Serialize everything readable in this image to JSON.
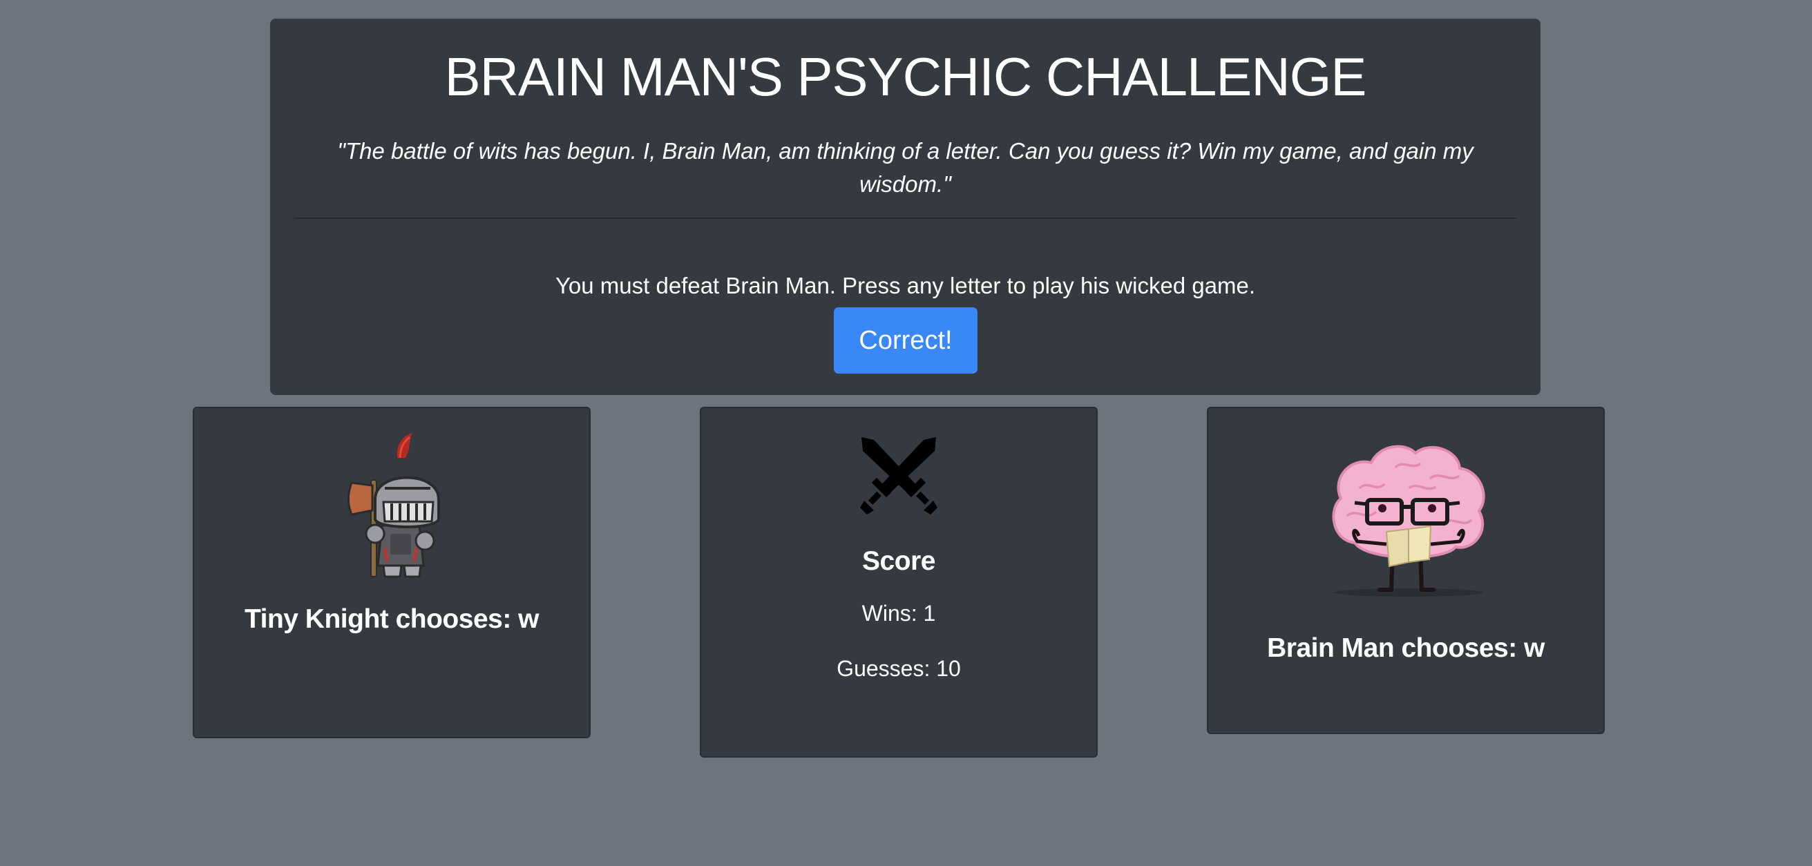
{
  "header": {
    "title": "BRAIN MAN'S PSYCHIC CHALLENGE",
    "quote": "\"The battle of wits has begun. I, Brain Man, am thinking of a letter. Can you guess it? Win my game, and gain my wisdom.\"",
    "instructions": "You must defeat Brain Man. Press any letter to play his wicked game.",
    "result_button_label": "Correct!"
  },
  "player": {
    "icon": "knight-icon",
    "choice_text": "Tiny Knight chooses: w"
  },
  "score": {
    "icon": "crossed-swords-icon",
    "heading": "Score",
    "wins_text": "Wins: 1",
    "guesses_text": "Guesses: 10"
  },
  "opponent": {
    "icon": "brain-man-icon",
    "choice_text": "Brain Man chooses: w"
  },
  "colors": {
    "background": "#6c757d",
    "panel": "#343a40",
    "button": "#3a87f7",
    "text": "#ffffff"
  }
}
